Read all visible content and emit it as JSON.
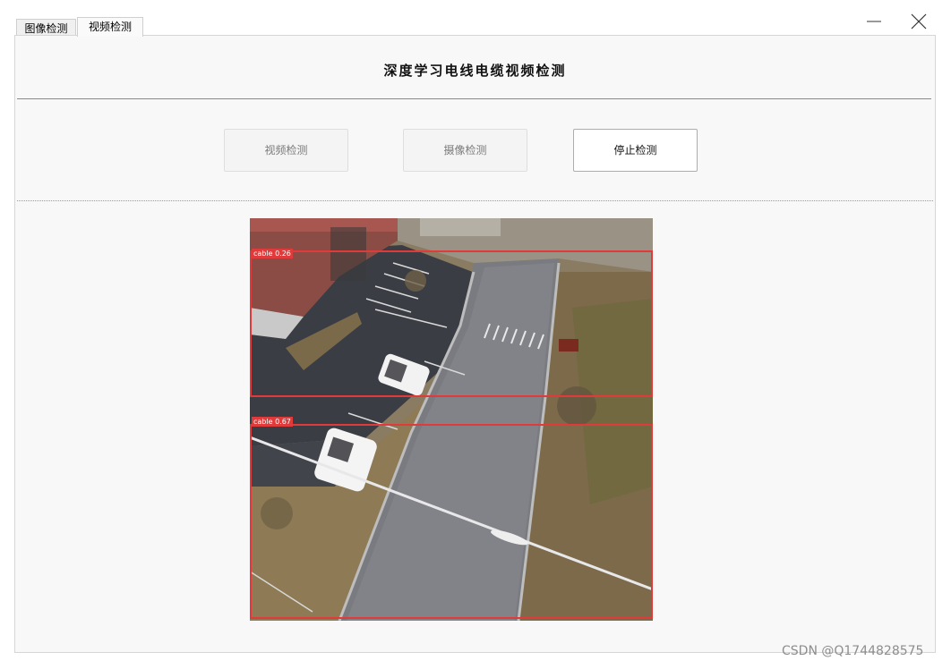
{
  "tabs": [
    {
      "label": "图像检测"
    },
    {
      "label": "视频检测"
    }
  ],
  "main": {
    "title": "深度学习电线电缆视频检测",
    "buttons": {
      "video_detect": "视频检测",
      "camera_detect": "摄像检测",
      "stop_detect": "停止检测"
    }
  },
  "video_frame": {
    "detections": [
      {
        "label": "cable 0.26",
        "class": "cable",
        "confidence": 0.26
      },
      {
        "label": "cable 0.67",
        "class": "cable",
        "confidence": 0.67
      }
    ],
    "box_color": "#e03a3a"
  },
  "watermark": "CSDN @Q1744828575"
}
